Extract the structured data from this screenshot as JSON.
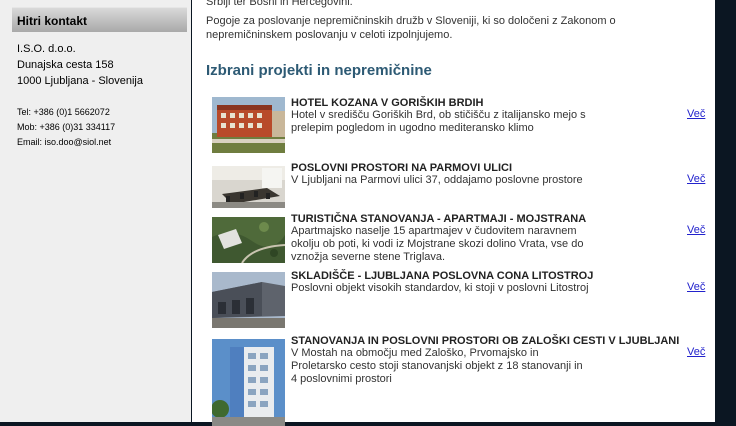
{
  "sidebar": {
    "heading": "Hitri kontakt",
    "company": "I.S.O. d.o.o.",
    "street": "Dunajska cesta 158",
    "city": "1000 Ljubljana - Slovenija",
    "tel": "Tel: +386 (0)1 5662072",
    "mob": "Mob: +386 (0)31 334117",
    "email": "Email: iso.doo@siol.net"
  },
  "main": {
    "intro_cut": "Srbiji ter Bosni in Hercegovini.",
    "intro_text": "Pogoje za poslovanje nepremičninskih družb v Sloveniji, ki so določeni z Zakonom o nepremičninskem poslovanju v celoti izpolnjujemo.",
    "section_title": "Izbrani projekti in nepremičnine",
    "more_label": "Več",
    "projects": [
      {
        "title": "HOTEL KOZANA V GORIŠKIH BRDIH",
        "desc": "Hotel v središču Goriških Brd, ob stičišču z italijansko mejo s prelepim pogledom in ugodno mediteransko klimo",
        "thumb": "hotel-photo"
      },
      {
        "title": "POSLOVNI PROSTORI NA PARMOVI ULICI",
        "desc": "V Ljubljani na Parmovi ulici 37, oddajamo poslovne prostore",
        "thumb": "office-photo"
      },
      {
        "title": "TURISTIČNA STANOVANJA - APARTMAJI - MOJSTRANA",
        "desc": "Apartmajsko naselje 15 apartmajev v čudovitem naravnem okolju ob poti, ki vodi iz Mojstrane skozi dolino Vrata, vse do vznožja severne stene Triglava.",
        "thumb": "aerial-photo"
      },
      {
        "title": "SKLADIŠČE - LJUBLJANA POSLOVNA CONA LITOSTROJ",
        "desc": "Poslovni objekt visokih standardov, ki stoji v poslovni Litostroj",
        "thumb": "warehouse-photo"
      },
      {
        "title": "STANOVANJA IN POSLOVNI PROSTORI OB ZALOŠKI CESTI V LJUBLJANI",
        "desc": "V Mostah na območju med Zaloško, Prvomajsko in Proletarsko cesto stoji stanovanjski objekt z 18 stanovanji in 4 poslovnimi prostori",
        "thumb": "apartment-building-photo"
      }
    ]
  }
}
